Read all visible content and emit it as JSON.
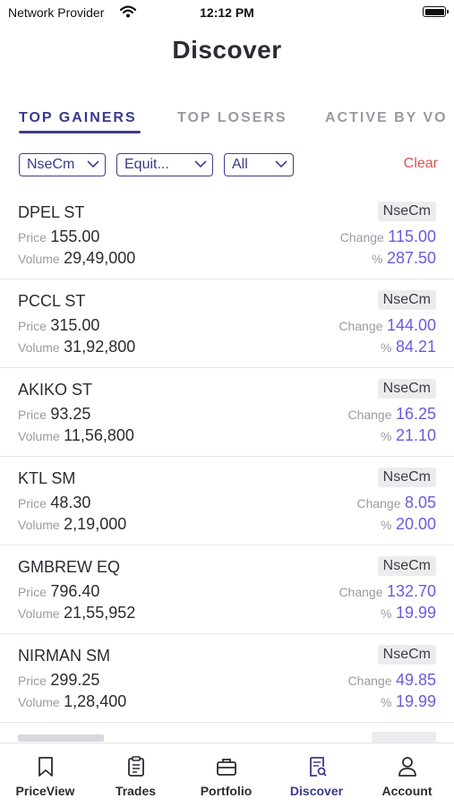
{
  "status": {
    "carrier": "Network Provider",
    "time": "12:12 PM"
  },
  "title": "Discover",
  "tabs": [
    {
      "label": "TOP GAINERS",
      "active": true
    },
    {
      "label": "TOP LOSERS",
      "active": false
    },
    {
      "label": "ACTIVE BY VO",
      "active": false
    }
  ],
  "filters": {
    "exchange": "NseCm",
    "segment": "Equit...",
    "group": "All",
    "clear": "Clear"
  },
  "labels": {
    "price": "Price",
    "volume": "Volume",
    "change": "Change",
    "percent": "%"
  },
  "rows": [
    {
      "symbol": "DPEL ST",
      "exchange": "NseCm",
      "price": "155.00",
      "volume": "29,49,000",
      "change": "115.00",
      "percent": "287.50"
    },
    {
      "symbol": "PCCL ST",
      "exchange": "NseCm",
      "price": "315.00",
      "volume": "31,92,800",
      "change": "144.00",
      "percent": "84.21"
    },
    {
      "symbol": "AKIKO ST",
      "exchange": "NseCm",
      "price": "93.25",
      "volume": "11,56,800",
      "change": "16.25",
      "percent": "21.10"
    },
    {
      "symbol": "KTL SM",
      "exchange": "NseCm",
      "price": "48.30",
      "volume": "2,19,000",
      "change": "8.05",
      "percent": "20.00"
    },
    {
      "symbol": "GMBREW EQ",
      "exchange": "NseCm",
      "price": "796.40",
      "volume": "21,55,952",
      "change": "132.70",
      "percent": "19.99"
    },
    {
      "symbol": "NIRMAN SM",
      "exchange": "NseCm",
      "price": "299.25",
      "volume": "1,28,400",
      "change": "49.85",
      "percent": "19.99"
    }
  ],
  "nav": [
    {
      "label": "PriceView",
      "icon": "bookmark-icon"
    },
    {
      "label": "Trades",
      "icon": "clipboard-icon"
    },
    {
      "label": "Portfolio",
      "icon": "briefcase-icon"
    },
    {
      "label": "Discover",
      "icon": "search-document-icon",
      "active": true
    },
    {
      "label": "Account",
      "icon": "person-icon"
    }
  ],
  "colors": {
    "accent": "#3a3a8a",
    "value": "#6a5ae0",
    "clear": "#d9534f"
  }
}
